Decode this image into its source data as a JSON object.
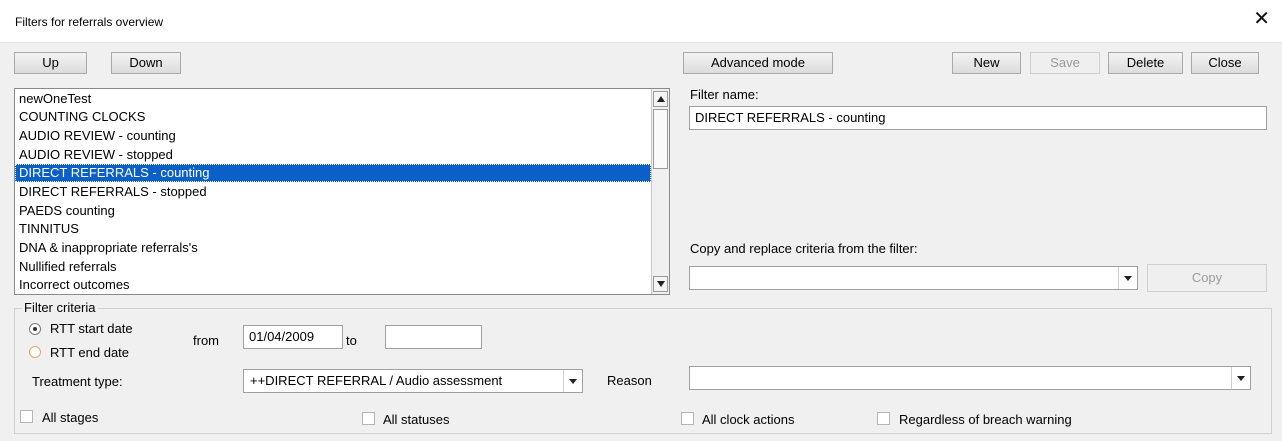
{
  "window": {
    "title": "Filters for referrals overview",
    "close_glyph": "✕"
  },
  "toolbar": {
    "up_label": "Up",
    "down_label": "Down",
    "advanced_label": "Advanced mode",
    "new_label": "New",
    "save_label": "Save",
    "delete_label": "Delete",
    "close_label": "Close"
  },
  "filter_list": {
    "items": [
      "newOneTest",
      "COUNTING CLOCKS",
      "AUDIO REVIEW - counting",
      "AUDIO REVIEW - stopped",
      "DIRECT REFERRALS - counting",
      "DIRECT REFERRALS - stopped",
      "PAEDS counting",
      "TINNITUS",
      "DNA & inappropriate referrals's",
      "Nullified referrals",
      "Incorrect outcomes"
    ],
    "selected_index": 4
  },
  "filter_name": {
    "label": "Filter name:",
    "value": "DIRECT REFERRALS - counting"
  },
  "copy_section": {
    "label": "Copy and replace criteria from the filter:",
    "value": "",
    "copy_label": "Copy"
  },
  "criteria": {
    "title": "Filter criteria",
    "rtt_start_label": "RTT start date",
    "rtt_end_label": "RTT end date",
    "from_label": "from",
    "from_value": "01/04/2009",
    "to_label": "to",
    "to_value": "",
    "treatment_label": "Treatment type:",
    "treatment_value": "++DIRECT REFERRAL / Audio assessment",
    "reason_label": "Reason",
    "reason_value": "",
    "all_stages_label": "All stages",
    "all_statuses_label": "All statuses",
    "all_clock_actions_label": "All clock actions",
    "breach_warning_label": "Regardless of breach warning"
  },
  "colors": {
    "selection": "#0a60c8",
    "radio_inactive": "#e6a36a"
  }
}
